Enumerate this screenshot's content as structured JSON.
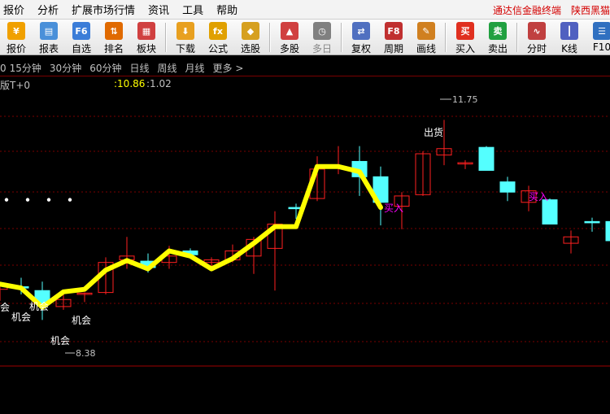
{
  "menu": {
    "items": [
      "报价",
      "分析",
      "扩展市场行情",
      "资讯",
      "工具",
      "帮助"
    ],
    "brand_left": "通达信金融终端",
    "brand_right": "陕西黑猫"
  },
  "toolbar": {
    "buttons": [
      {
        "label": "报价",
        "icon": "yen-icon",
        "glyph": "¥",
        "color": "#f0a000",
        "dim": false
      },
      {
        "label": "报表",
        "icon": "report-icon",
        "glyph": "▤",
        "color": "#4a90d9",
        "dim": false
      },
      {
        "label": "自选",
        "icon": "f6-icon",
        "glyph": "F6",
        "color": "#3b7dd8",
        "dim": false
      },
      {
        "label": "排名",
        "icon": "rank-icon",
        "glyph": "⇅",
        "color": "#e06a00",
        "dim": false
      },
      {
        "label": "板块",
        "icon": "sector-icon",
        "glyph": "▦",
        "color": "#d04040",
        "dim": false
      },
      {
        "label": "下载",
        "icon": "download-icon",
        "glyph": "⬇",
        "color": "#e8a020",
        "dim": false
      },
      {
        "label": "公式",
        "icon": "formula-icon",
        "glyph": "fx",
        "color": "#e0a000",
        "dim": false
      },
      {
        "label": "选股",
        "icon": "stock-picker-icon",
        "glyph": "◆",
        "color": "#d6a020",
        "dim": false
      },
      {
        "label": "多股",
        "icon": "multi-stock-icon",
        "glyph": "▲",
        "color": "#d04040",
        "dim": false
      },
      {
        "label": "多日",
        "icon": "multi-day-icon",
        "glyph": "◷",
        "color": "#808080",
        "dim": true
      },
      {
        "label": "复权",
        "icon": "adjust-icon",
        "glyph": "⇄",
        "color": "#5070c0",
        "dim": false
      },
      {
        "label": "周期",
        "icon": "f8-icon",
        "glyph": "F8",
        "color": "#c03030",
        "dim": false
      },
      {
        "label": "画线",
        "icon": "draw-line-icon",
        "glyph": "✎",
        "color": "#d08020",
        "dim": false
      },
      {
        "label": "买入",
        "icon": "buy-icon",
        "glyph": "买",
        "color": "#e03020",
        "dim": false
      },
      {
        "label": "卖出",
        "icon": "sell-icon",
        "glyph": "卖",
        "color": "#20a040",
        "dim": false
      },
      {
        "label": "分时",
        "icon": "intraday-icon",
        "glyph": "∿",
        "color": "#c04040",
        "dim": false
      },
      {
        "label": "K线",
        "icon": "kline-icon",
        "glyph": "┃",
        "color": "#5060c0",
        "dim": false
      },
      {
        "label": "F10",
        "icon": "f10-icon",
        "glyph": "☰",
        "color": "#3070c0",
        "dim": false
      }
    ]
  },
  "periods": [
    "0",
    "15分钟",
    "30分钟",
    "60分钟",
    "日线",
    "周线",
    "月线",
    "更多 >"
  ],
  "info": {
    "name": "版T+0",
    "value1": ":10.86",
    "value2": ":1.02"
  },
  "colors": {
    "up": "#ff2020",
    "down": "#54ffff",
    "line": "#ffff00",
    "grid": "#7a0000",
    "signal_buy": "#ff00ff",
    "text": "#c0c0c0"
  },
  "annotations": {
    "high_label": "11.75",
    "low_label": "8.38",
    "opp1": "机会",
    "opp2": "机会",
    "opp3": "机会",
    "opp4": "机会",
    "buy1": "买入",
    "buy2": "买入",
    "sell1": "出货",
    "edge_char": "会"
  },
  "chart_data": {
    "type": "candlestick",
    "ylim": [
      7.9,
      12.2
    ],
    "candles": [
      {
        "o": 9.1,
        "h": 9.18,
        "l": 8.92,
        "c": 9.16
      },
      {
        "o": 9.14,
        "h": 9.28,
        "l": 9.02,
        "c": 9.12
      },
      {
        "o": 9.08,
        "h": 9.22,
        "l": 8.62,
        "c": 8.88
      },
      {
        "o": 8.83,
        "h": 9.08,
        "l": 8.78,
        "c": 8.94
      },
      {
        "o": 9.02,
        "h": 9.05,
        "l": 8.9,
        "c": 9.04
      },
      {
        "o": 9.05,
        "h": 9.6,
        "l": 9.02,
        "c": 9.52
      },
      {
        "o": 9.56,
        "h": 9.92,
        "l": 9.42,
        "c": 9.62
      },
      {
        "o": 9.54,
        "h": 9.66,
        "l": 9.36,
        "c": 9.44
      },
      {
        "o": 9.52,
        "h": 9.78,
        "l": 9.42,
        "c": 9.62
      },
      {
        "o": 9.7,
        "h": 9.74,
        "l": 9.58,
        "c": 9.64
      },
      {
        "o": 9.52,
        "h": 9.6,
        "l": 9.46,
        "c": 9.56
      },
      {
        "o": 9.56,
        "h": 9.8,
        "l": 9.52,
        "c": 9.7
      },
      {
        "o": 9.62,
        "h": 9.92,
        "l": 9.34,
        "c": 9.88
      },
      {
        "o": 9.74,
        "h": 10.32,
        "l": 9.08,
        "c": 10.12
      },
      {
        "o": 10.38,
        "h": 10.44,
        "l": 10.2,
        "c": 10.36
      },
      {
        "o": 10.52,
        "h": 11.18,
        "l": 10.48,
        "c": 10.98
      },
      {
        "o": 11.0,
        "h": 11.34,
        "l": 10.9,
        "c": 11.02
      },
      {
        "o": 11.1,
        "h": 11.34,
        "l": 10.56,
        "c": 10.86
      },
      {
        "o": 10.86,
        "h": 11.02,
        "l": 10.1,
        "c": 10.46
      },
      {
        "o": 10.4,
        "h": 10.62,
        "l": 10.04,
        "c": 10.56
      },
      {
        "o": 10.58,
        "h": 11.26,
        "l": 10.56,
        "c": 11.22
      },
      {
        "o": 11.2,
        "h": 11.75,
        "l": 11.04,
        "c": 11.3
      },
      {
        "o": 11.06,
        "h": 11.12,
        "l": 10.98,
        "c": 11.08
      },
      {
        "o": 11.32,
        "h": 11.34,
        "l": 10.98,
        "c": 10.96
      },
      {
        "o": 10.78,
        "h": 10.86,
        "l": 10.48,
        "c": 10.62
      },
      {
        "o": 10.46,
        "h": 10.72,
        "l": 10.32,
        "c": 10.64
      },
      {
        "o": 10.5,
        "h": 10.52,
        "l": 10.12,
        "c": 10.12
      },
      {
        "o": 9.82,
        "h": 10.02,
        "l": 9.66,
        "c": 9.92
      },
      {
        "o": 10.16,
        "h": 10.22,
        "l": 10.0,
        "c": 10.14
      },
      {
        "o": 10.16,
        "h": 10.22,
        "l": 9.82,
        "c": 9.86
      }
    ],
    "line": [
      9.18,
      9.12,
      8.82,
      9.06,
      9.1,
      9.4,
      9.55,
      9.42,
      9.7,
      9.62,
      9.42,
      9.58,
      9.82,
      10.08,
      10.08,
      11.02,
      11.02,
      10.94,
      10.38
    ],
    "dots_y": 10.5,
    "dots_count": 4
  }
}
